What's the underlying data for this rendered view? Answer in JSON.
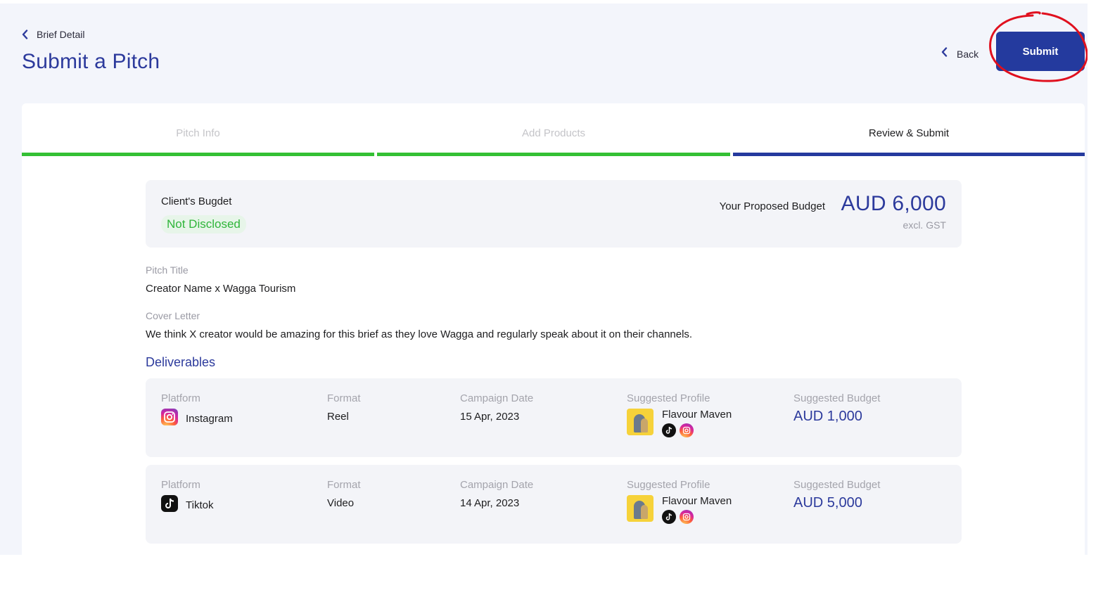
{
  "header": {
    "breadcrumb": "Brief Detail",
    "title": "Submit a Pitch",
    "back_label": "Back",
    "submit_label": "Submit"
  },
  "steps": [
    {
      "label": "Pitch Info",
      "status": "completed"
    },
    {
      "label": "Add Products",
      "status": "completed"
    },
    {
      "label": "Review & Submit",
      "status": "active"
    }
  ],
  "budget": {
    "client_label": "Client's Bugdet",
    "client_value": "Not Disclosed",
    "proposed_label": "Your Proposed Budget",
    "proposed_value": "AUD 6,000",
    "proposed_note": "excl. GST"
  },
  "pitch": {
    "title_label": "Pitch Title",
    "title_value": "Creator Name x Wagga Tourism",
    "cover_label": "Cover Letter",
    "cover_value": "We think X creator would be amazing for this brief as they love Wagga and regularly speak about it on their channels."
  },
  "deliverables": {
    "heading": "Deliverables",
    "columns": {
      "platform": "Platform",
      "format": "Format",
      "date": "Campaign Date",
      "profile": "Suggested Profile",
      "budget": "Suggested Budget"
    },
    "rows": [
      {
        "platform": "Instagram",
        "platform_icon": "instagram-icon",
        "format": "Reel",
        "date": "15 Apr, 2023",
        "profile": "Flavour Maven",
        "budget": "AUD 1,000"
      },
      {
        "platform": "Tiktok",
        "platform_icon": "tiktok-icon",
        "format": "Video",
        "date": "14 Apr, 2023",
        "profile": "Flavour Maven",
        "budget": "AUD 5,000"
      }
    ]
  },
  "colors": {
    "primary": "#243a9e",
    "completed_step": "#34c034",
    "not_disclosed_text": "#2fb53a",
    "annotation": "#e0101e"
  }
}
